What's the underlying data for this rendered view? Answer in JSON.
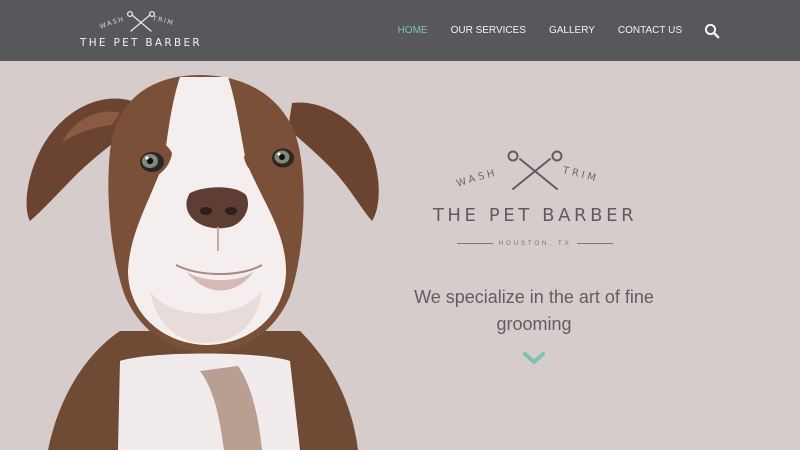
{
  "header": {
    "brand": {
      "arc_left": "WASH",
      "arc_right": "TRIM",
      "name": "THE PET BARBER"
    },
    "nav": [
      {
        "label": "HOME",
        "active": true
      },
      {
        "label": "OUR SERVICES",
        "active": false
      },
      {
        "label": "GALLERY",
        "active": false
      },
      {
        "label": "CONTACT US",
        "active": false
      }
    ],
    "search_icon": "search-icon"
  },
  "hero": {
    "logo": {
      "arc_left": "WASH",
      "arc_right": "TRIM",
      "name": "THE PET BARBER",
      "location": "HOUSTON, TX",
      "icon": "scissors-icon"
    },
    "tagline": "We specialize in the art of fine grooming",
    "scroll_icon": "chevron-down-icon"
  },
  "colors": {
    "header_bg": "#58575c",
    "hero_bg": "#d6cccb",
    "accent": "#7cc2b1",
    "text_dark": "#615e62"
  }
}
